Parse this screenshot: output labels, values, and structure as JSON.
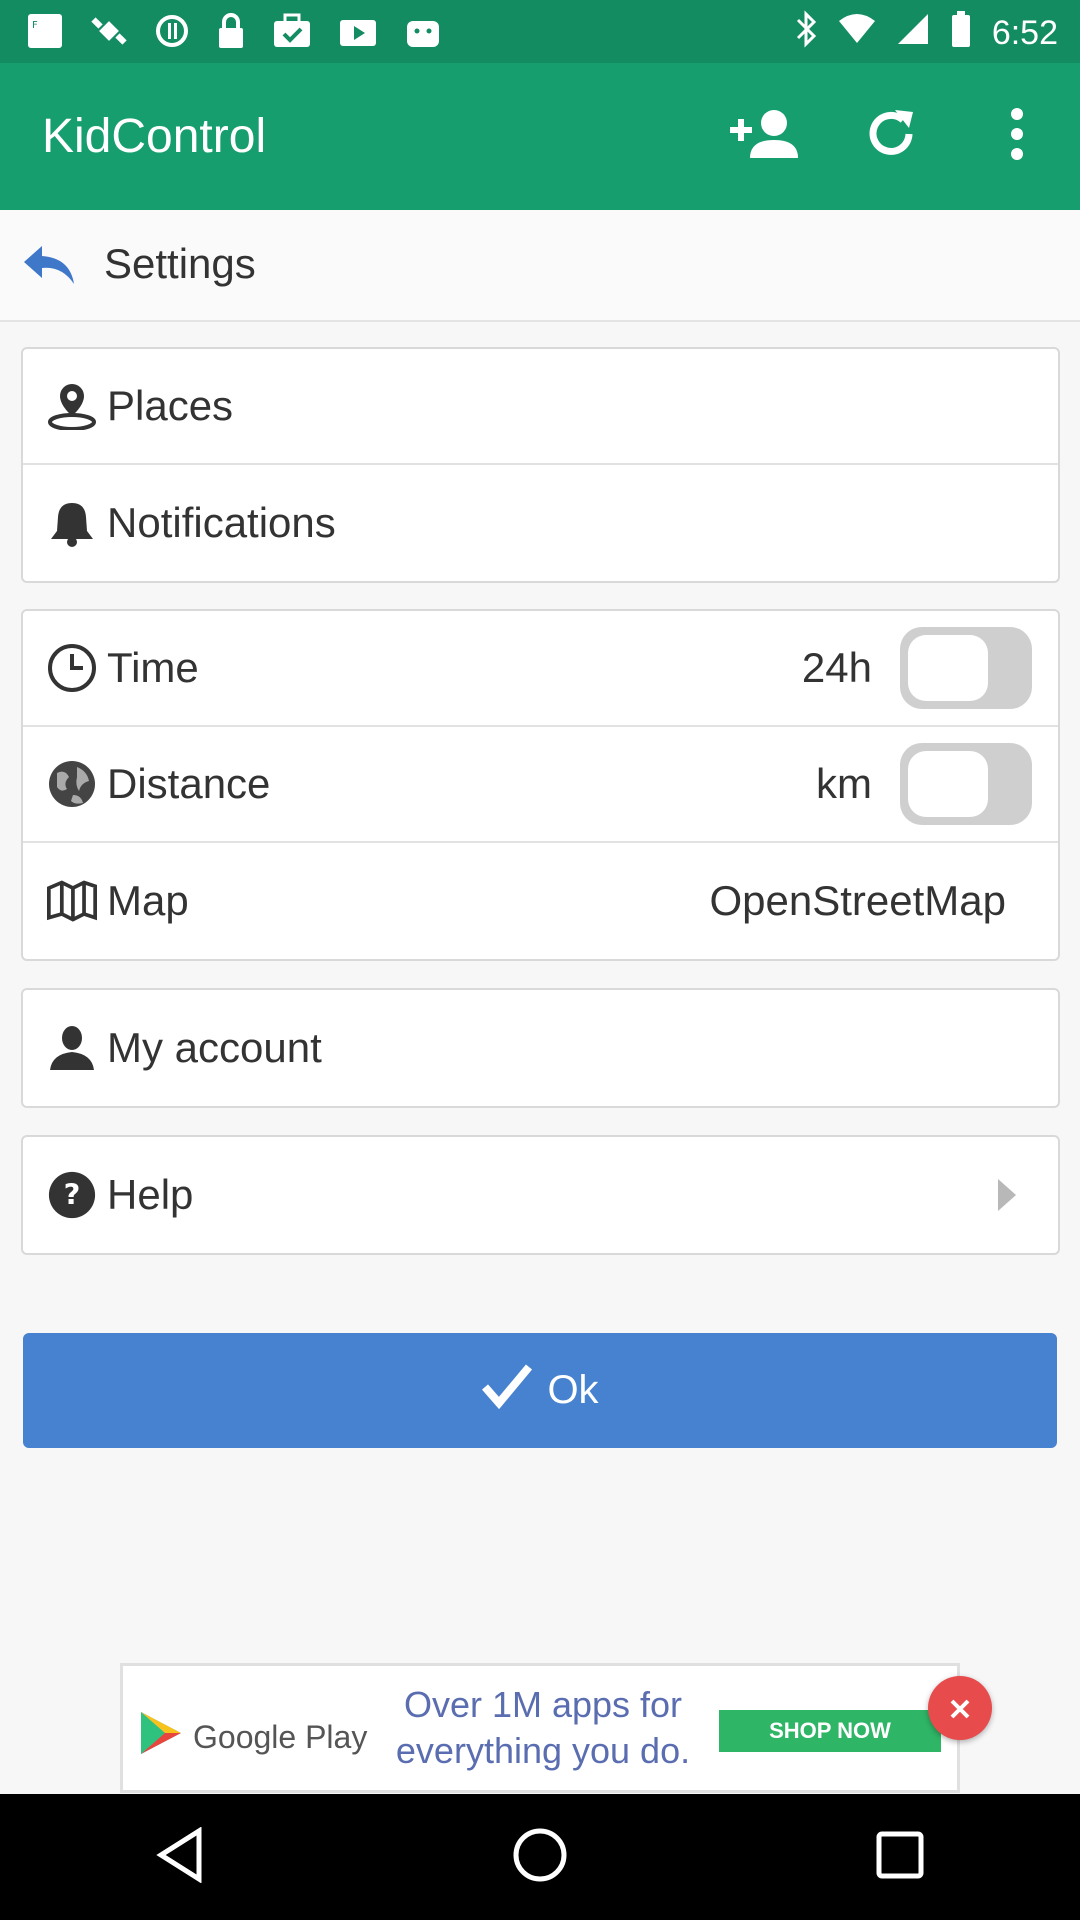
{
  "status_bar": {
    "time": "6:52",
    "icons": [
      "fake-gps-icon",
      "satellite-icon",
      "sync-icon",
      "lock-icon",
      "briefcase-check-icon",
      "play-store-icon",
      "android-icon",
      "bluetooth-icon",
      "wifi-icon",
      "signal-icon",
      "battery-icon"
    ]
  },
  "app_bar": {
    "title": "KidControl",
    "actions": [
      "add-person-icon",
      "refresh-icon",
      "more-vert-icon"
    ]
  },
  "settings_header": {
    "title": "Settings",
    "back_icon": "reply-icon"
  },
  "groups": {
    "first": {
      "places": {
        "label": "Places",
        "icon": "map-pin-icon"
      },
      "notifications": {
        "label": "Notifications",
        "icon": "bell-icon"
      }
    },
    "units": {
      "time": {
        "label": "Time",
        "value": "24h",
        "icon": "clock-icon",
        "toggle_on": false
      },
      "distance": {
        "label": "Distance",
        "value": "km",
        "icon": "globe-icon",
        "toggle_on": false
      },
      "map": {
        "label": "Map",
        "value": "OpenStreetMap",
        "icon": "map-icon"
      }
    },
    "account": {
      "label": "My account",
      "icon": "user-icon"
    },
    "help": {
      "label": "Help",
      "icon": "question-icon"
    }
  },
  "ok_button": {
    "label": "Ok",
    "color": "#4682cf"
  },
  "ad": {
    "brand": "Google Play",
    "text": "Over 1M apps for everything you do.",
    "cta": "SHOP NOW"
  },
  "colors": {
    "status_bar": "#138c62",
    "app_bar": "#179e6f",
    "ok_button": "#4682cf",
    "ad_close": "#e74b4b"
  }
}
